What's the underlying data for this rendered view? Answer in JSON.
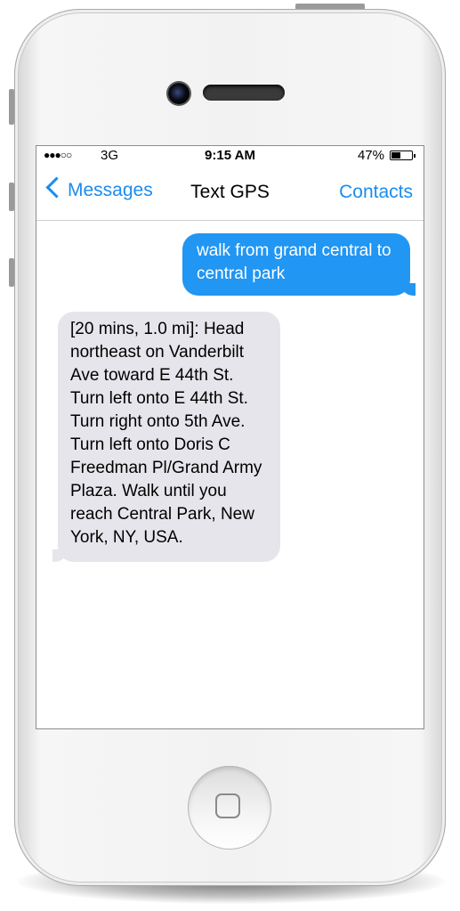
{
  "status_bar": {
    "signal": "●●●○○",
    "network": "3G",
    "time": "9:15 AM",
    "battery_percent": "47%",
    "battery_level": 0.47
  },
  "nav_bar": {
    "back_label": "Messages",
    "title": "Text GPS",
    "right_label": "Contacts"
  },
  "messages": [
    {
      "direction": "outgoing",
      "text": "walk from grand central to central park"
    },
    {
      "direction": "incoming",
      "text": "[20 mins, 1.0 mi]: Head northeast on Vanderbilt Ave toward E 44th St. Turn left onto E 44th St. Turn right onto 5th Ave. Turn left onto Doris C Freedman Pl/Grand Army Plaza. Walk until you reach Central Park, New York, NY, USA."
    }
  ],
  "colors": {
    "accent": "#1a8cf0",
    "outgoing_bubble": "#2196f3",
    "incoming_bubble": "#e6e5eb"
  }
}
